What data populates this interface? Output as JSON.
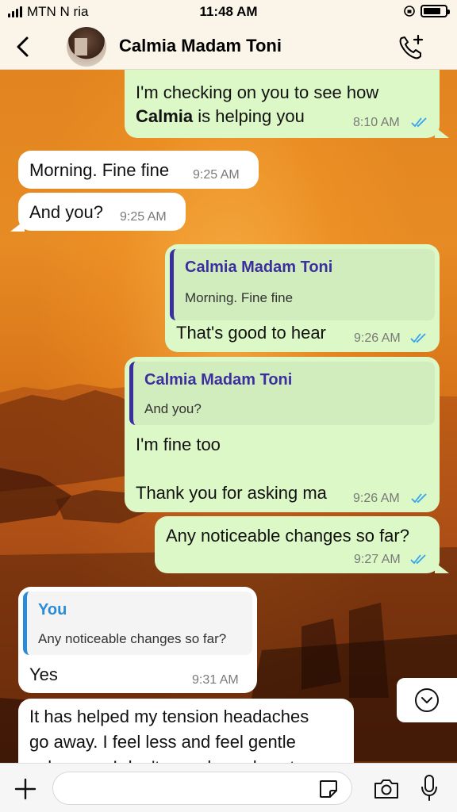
{
  "status_bar": {
    "carrier": "MTN N   ria",
    "time": "11:48 AM"
  },
  "header": {
    "contact_name": "Calmia Madam Toni",
    "icons": [
      "back-chevron-icon",
      "avatar",
      "add-call-icon"
    ]
  },
  "messages": [
    {
      "direction": "outgoing",
      "text_line1": "I'm checking on you to see how",
      "text_line2_bold": "Calmia",
      "text_line2_rest": " is helping you",
      "time": "8:10 AM",
      "read": true
    },
    {
      "direction": "incoming",
      "text": "Morning. Fine fine",
      "time": "9:25 AM"
    },
    {
      "direction": "incoming",
      "text": "And you?",
      "time": "9:25 AM"
    },
    {
      "direction": "outgoing",
      "quote_name": "Calmia Madam Toni",
      "quote_text": "Morning. Fine fine",
      "text": "That's good to hear",
      "time": "9:26 AM",
      "read": true
    },
    {
      "direction": "outgoing",
      "quote_name": "Calmia Madam Toni",
      "quote_text": "And you?",
      "text_line1": "I'm fine too",
      "text_line2": "Thank you for asking ma",
      "time": "9:26 AM",
      "read": true
    },
    {
      "direction": "outgoing",
      "text": "Any noticeable changes so far?",
      "time": "9:27 AM",
      "read": true
    },
    {
      "direction": "incoming",
      "quote_name": "You",
      "quote_text": "Any noticeable changes so far?",
      "text": "Yes",
      "time": "9:31 AM"
    },
    {
      "direction": "incoming",
      "text_line1": "It has helped my tension headaches",
      "text_line2": "go away. I feel less and feel gentle",
      "text_line3": "calmness. I don't even know how to"
    }
  ],
  "input_bar": {
    "placeholder": "",
    "icons": [
      "plus-icon",
      "sticker-icon",
      "camera-icon",
      "microphone-icon"
    ]
  },
  "colors": {
    "outgoing_bubble": "#dcf8c6",
    "incoming_bubble": "#ffffff",
    "read_ticks": "#34a3f0",
    "quote_name_contact": "#3b2fa0",
    "quote_name_you": "#2a8bd6",
    "header_bg": "#fbf5e9"
  }
}
